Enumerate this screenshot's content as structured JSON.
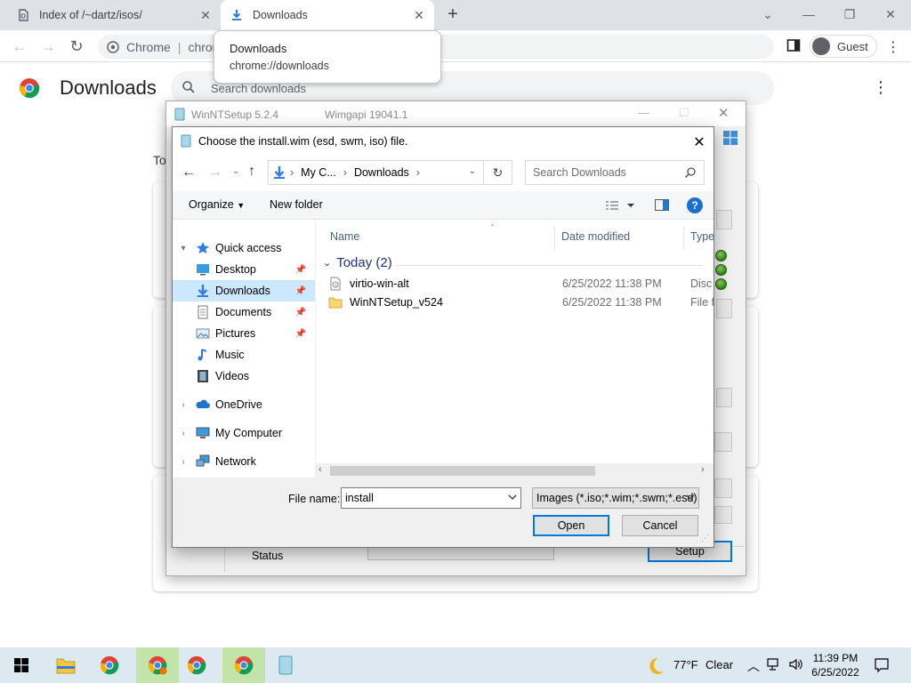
{
  "browser": {
    "tabs": [
      {
        "label": "Index of /~dartz/isos/",
        "icon": "document-icon"
      },
      {
        "label": "Downloads",
        "icon": "download-icon"
      }
    ],
    "omnibox": {
      "site": "Chrome",
      "url": "chrom"
    },
    "profile_label": "Guest",
    "tooltip": {
      "title": "Downloads",
      "url": "chrome://downloads"
    }
  },
  "downloads_page": {
    "title": "Downloads",
    "search_placeholder": "Search downloads",
    "section_label": "To"
  },
  "winntsetup": {
    "title": "WinNTSetup 5.2.4",
    "wimgapi": "Wimgapi 19041.1",
    "status_label": "Status",
    "setup_button": "Setup"
  },
  "file_dialog": {
    "title": "Choose the install.wim (esd, swm, iso) file.",
    "breadcrumb": [
      "My C...",
      "Downloads"
    ],
    "search_placeholder": "Search Downloads",
    "organize_label": "Organize",
    "new_folder_label": "New folder",
    "nav": [
      {
        "label": "Quick access",
        "icon": "star-icon",
        "level": 0,
        "expanded": true
      },
      {
        "label": "Desktop",
        "icon": "desktop-icon",
        "level": 1,
        "pinned": true
      },
      {
        "label": "Downloads",
        "icon": "download-folder-icon",
        "level": 1,
        "pinned": true,
        "selected": true
      },
      {
        "label": "Documents",
        "icon": "documents-icon",
        "level": 1,
        "pinned": true
      },
      {
        "label": "Pictures",
        "icon": "pictures-icon",
        "level": 1,
        "pinned": true
      },
      {
        "label": "Music",
        "icon": "music-icon",
        "level": 1
      },
      {
        "label": "Videos",
        "icon": "videos-icon",
        "level": 1
      },
      {
        "label": "OneDrive",
        "icon": "cloud-icon",
        "level": 0
      },
      {
        "label": "My Computer",
        "icon": "computer-icon",
        "level": 0
      },
      {
        "label": "Network",
        "icon": "network-icon",
        "level": 0
      }
    ],
    "columns": [
      "Name",
      "Date modified",
      "Type"
    ],
    "group_label": "Today (2)",
    "files": [
      {
        "name": "virtio-win-alt",
        "date": "6/25/2022 11:38 PM",
        "type": "Disc",
        "icon": "disc-image-icon"
      },
      {
        "name": "WinNTSetup_v524",
        "date": "6/25/2022 11:38 PM",
        "type": "File folder",
        "icon": "folder-icon"
      }
    ],
    "file_name_label": "File name:",
    "file_name_value": "install",
    "filter_value": "Images (*.iso;*.wim;*.swm;*.esd)",
    "open_label": "Open",
    "cancel_label": "Cancel"
  },
  "taskbar": {
    "weather": {
      "temp": "77°F",
      "condition": "Clear"
    },
    "time": "11:39 PM",
    "date": "6/25/2022"
  },
  "colors": {
    "accent": "#0078d7",
    "selection": "#cce8ff",
    "taskbar": "#dde9f0"
  }
}
